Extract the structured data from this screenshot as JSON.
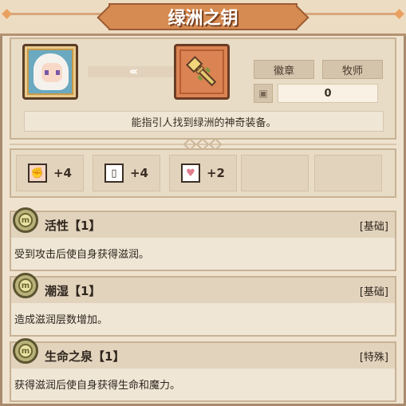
{
  "title": "绿洲之钥",
  "item": {
    "tag1": "徽章",
    "tag2": "牧师",
    "count": "0",
    "description": "能指引人找到绿洲的神奇装备。",
    "arrows": "‹‹‹"
  },
  "stats": [
    {
      "icon": "fist-icon",
      "value": "+4"
    },
    {
      "icon": "book-icon",
      "value": "+4"
    },
    {
      "icon": "heart-icon",
      "value": "+2"
    }
  ],
  "skills": [
    {
      "name": "活性【1】",
      "type": "[基础]",
      "desc": "受到攻击后使自身获得滋润。"
    },
    {
      "name": "潮湿【1】",
      "type": "[基础]",
      "desc": "造成滋润层数增加。"
    },
    {
      "name": "生命之泉【1】",
      "type": "[特殊]",
      "desc": "获得滋润后使自身获得生命和魔力。"
    }
  ]
}
